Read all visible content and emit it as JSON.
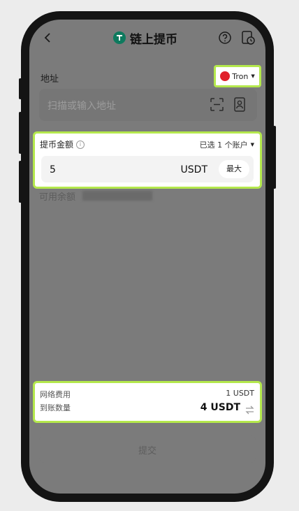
{
  "header": {
    "title": "链上提币"
  },
  "address": {
    "label": "地址",
    "network": "Tron",
    "placeholder": "扫描或输入地址"
  },
  "amount": {
    "label": "提币金额",
    "account_select": "已选 1 个账户",
    "value": "5",
    "unit": "USDT",
    "max_label": "最大"
  },
  "balance": {
    "label": "可用余额"
  },
  "fees": {
    "fee_label": "网络费用",
    "fee_value": "1 USDT",
    "receive_label": "到账数量",
    "receive_value": "4 USDT"
  },
  "submit_label": "提交",
  "colors": {
    "highlight": "#b4e84c",
    "overlay": "#7b7b7b",
    "tether": "#0e7a5e",
    "tron": "#e0212b"
  }
}
